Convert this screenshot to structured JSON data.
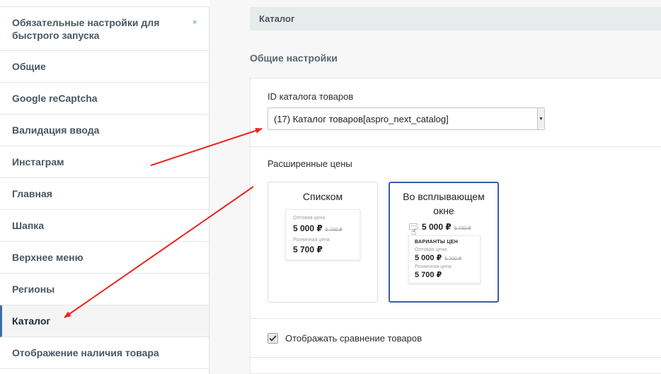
{
  "sidebar": {
    "star": "*",
    "items": [
      {
        "label": "Обязательные настройки для быстрого запуска"
      },
      {
        "label": "Общие"
      },
      {
        "label": "Google reCaptcha"
      },
      {
        "label": "Валидация ввода"
      },
      {
        "label": "Инстаграм"
      },
      {
        "label": "Главная"
      },
      {
        "label": "Шапка"
      },
      {
        "label": "Верхнее меню"
      },
      {
        "label": "Регионы"
      },
      {
        "label": "Каталог"
      },
      {
        "label": "Отображение наличия товара"
      }
    ],
    "active_item": "Каталог"
  },
  "main": {
    "section_title": "Каталог",
    "subhead": "Общие настройки",
    "catalog_id_label": "ID каталога товаров",
    "catalog_select_value": "(17) Каталог товаров[aspro_next_catalog]",
    "ext_prices_label": "Расширенные цены",
    "option_list": {
      "title": "Списком",
      "wholesale_label": "Оптовая цена",
      "wholesale_price": "5 000 ₽",
      "wholesale_old": "5 700 ₽",
      "retail_label": "Розничная цена",
      "retail_price": "5 700 ₽"
    },
    "option_popup": {
      "title_line1": "Во всплывающем",
      "title_line2": "окне",
      "top_price": "5 000 ₽",
      "top_old": "5 700 ₽",
      "popup_header": "ВАРИАНТЫ ЦЕН",
      "wholesale_label": "Оптовая цена",
      "wholesale_price": "5 000 ₽",
      "wholesale_old": "5 700 ₽",
      "retail_label": "Розничная цена",
      "retail_price": "5 700 ₽"
    },
    "compare_checkbox_label": "Отображать сравнение товаров",
    "compare_checked": true
  },
  "colors": {
    "annotation_arrow": "#e8261d",
    "active_accent": "#3e6ea8",
    "selected_card_border": "#3a5fa7"
  }
}
